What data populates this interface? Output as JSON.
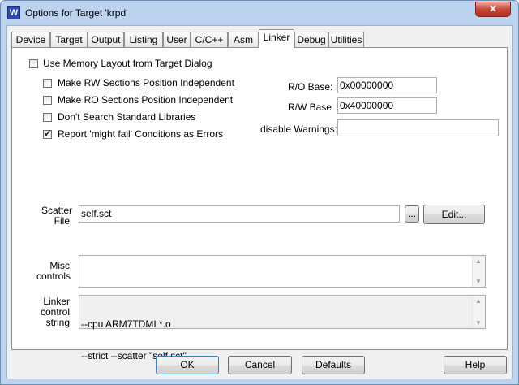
{
  "window": {
    "title": "Options for Target 'krpd'",
    "icon": "W",
    "close_label": "✕"
  },
  "tabs": [
    {
      "label": "Device"
    },
    {
      "label": "Target"
    },
    {
      "label": "Output"
    },
    {
      "label": "Listing"
    },
    {
      "label": "User"
    },
    {
      "label": "C/C++"
    },
    {
      "label": "Asm"
    },
    {
      "label": "Linker"
    },
    {
      "label": "Debug"
    },
    {
      "label": "Utilities"
    }
  ],
  "active_tab": "Linker",
  "linker": {
    "use_memory_layout": {
      "label": "Use Memory Layout from Target Dialog",
      "checked": false
    },
    "rw_independent": {
      "label": "Make RW Sections Position Independent",
      "checked": false
    },
    "ro_independent": {
      "label": "Make RO Sections Position Independent",
      "checked": false
    },
    "dont_search_std": {
      "label": "Don't Search Standard Libraries",
      "checked": false
    },
    "might_fail_errors": {
      "label": "Report 'might fail' Conditions as Errors",
      "checked": true
    },
    "ro_base": {
      "label": "R/O Base:",
      "value": "0x00000000"
    },
    "rw_base": {
      "label": "R/W Base",
      "value": "0x40000000"
    },
    "disable_warnings": {
      "label": "disable Warnings:",
      "value": ""
    },
    "scatter_file": {
      "label_line1": "Scatter",
      "label_line2": "File",
      "value": "self.sct",
      "browse_label": "...",
      "edit_label": "Edit..."
    },
    "misc_controls": {
      "label_line1": "Misc",
      "label_line2": "controls",
      "value": ""
    },
    "linker_control_string": {
      "label_line1": "Linker",
      "label_line2": "control",
      "label_line3": "string",
      "line1": "--cpu ARM7TDMI *.o",
      "line2": "--strict --scatter \"self.sct\""
    }
  },
  "footer": {
    "ok": "OK",
    "cancel": "Cancel",
    "defaults": "Defaults",
    "help": "Help"
  }
}
